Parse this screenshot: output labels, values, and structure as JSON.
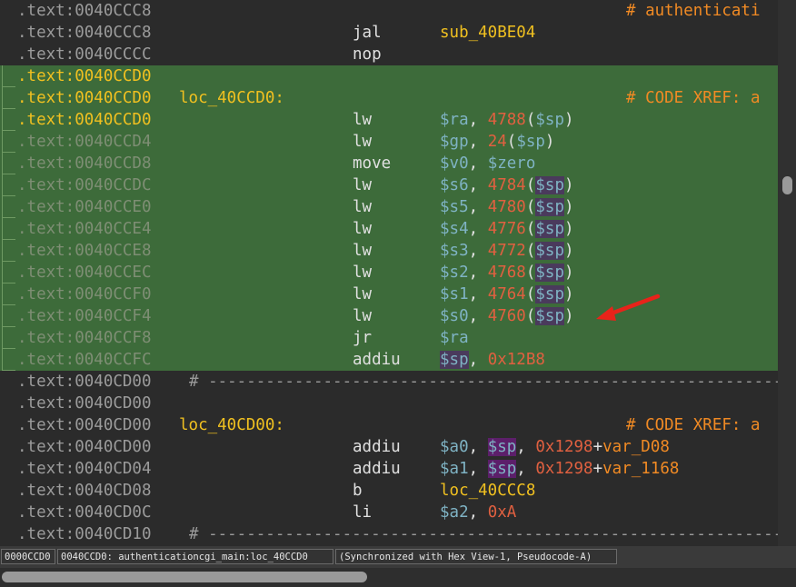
{
  "lines": [
    {
      "addr": ".text:0040CCC8",
      "label": "",
      "mn": "",
      "ops": [],
      "comment": "# authenticati",
      "hl": false,
      "ac": "c-dim"
    },
    {
      "addr": ".text:0040CCC8",
      "label": "",
      "mn": "jal",
      "ops": [
        {
          "t": "sub_40BE04",
          "c": "c-fn"
        }
      ],
      "comment": "",
      "hl": false,
      "ac": "c-dim"
    },
    {
      "addr": ".text:0040CCCC",
      "label": "",
      "mn": "nop",
      "ops": [],
      "comment": "",
      "hl": false,
      "ac": "c-dim"
    },
    {
      "addr": ".text:0040CCD0",
      "label": "",
      "mn": "",
      "ops": [],
      "comment": "",
      "hl": true,
      "ac": "c-cur"
    },
    {
      "addr": ".text:0040CCD0",
      "label": "loc_40CCD0:",
      "mn": "",
      "ops": [],
      "comment": "# CODE XREF: a",
      "hl": true,
      "ac": "c-cur"
    },
    {
      "addr": ".text:0040CCD0",
      "label": "",
      "mn": "lw",
      "ops": [
        {
          "t": "$ra",
          "c": "c-reg"
        },
        {
          "t": ", ",
          "c": "c-w"
        },
        {
          "t": "4788",
          "c": "c-num"
        },
        {
          "t": "(",
          "c": "c-w"
        },
        {
          "t": "$sp",
          "c": "c-reg"
        },
        {
          "t": ")",
          "c": "c-w"
        }
      ],
      "comment": "",
      "hl": true,
      "ac": "c-cur"
    },
    {
      "addr": ".text:0040CCD4",
      "label": "",
      "mn": "lw",
      "ops": [
        {
          "t": "$gp",
          "c": "c-reg"
        },
        {
          "t": ", ",
          "c": "c-w"
        },
        {
          "t": "24",
          "c": "c-num"
        },
        {
          "t": "(",
          "c": "c-w"
        },
        {
          "t": "$sp",
          "c": "c-reg"
        },
        {
          "t": ")",
          "c": "c-w"
        }
      ],
      "comment": "",
      "hl": true,
      "ac": "c-dimg"
    },
    {
      "addr": ".text:0040CCD8",
      "label": "",
      "mn": "move",
      "ops": [
        {
          "t": "$v0",
          "c": "c-reg"
        },
        {
          "t": ", ",
          "c": "c-w"
        },
        {
          "t": "$zero",
          "c": "c-reg"
        }
      ],
      "comment": "",
      "hl": true,
      "ac": "c-dimg"
    },
    {
      "addr": ".text:0040CCDC",
      "label": "",
      "mn": "lw",
      "ops": [
        {
          "t": "$s6",
          "c": "c-reg"
        },
        {
          "t": ", ",
          "c": "c-w"
        },
        {
          "t": "4784",
          "c": "c-num"
        },
        {
          "t": "(",
          "c": "c-w"
        },
        {
          "t": "$sp",
          "c": "c-reg",
          "h": 1
        },
        {
          "t": ")",
          "c": "c-w"
        }
      ],
      "comment": "",
      "hl": true,
      "ac": "c-dimg"
    },
    {
      "addr": ".text:0040CCE0",
      "label": "",
      "mn": "lw",
      "ops": [
        {
          "t": "$s5",
          "c": "c-reg"
        },
        {
          "t": ", ",
          "c": "c-w"
        },
        {
          "t": "4780",
          "c": "c-num"
        },
        {
          "t": "(",
          "c": "c-w"
        },
        {
          "t": "$sp",
          "c": "c-reg",
          "h": 1
        },
        {
          "t": ")",
          "c": "c-w"
        }
      ],
      "comment": "",
      "hl": true,
      "ac": "c-dimg"
    },
    {
      "addr": ".text:0040CCE4",
      "label": "",
      "mn": "lw",
      "ops": [
        {
          "t": "$s4",
          "c": "c-reg"
        },
        {
          "t": ", ",
          "c": "c-w"
        },
        {
          "t": "4776",
          "c": "c-num"
        },
        {
          "t": "(",
          "c": "c-w"
        },
        {
          "t": "$sp",
          "c": "c-reg",
          "h": 1
        },
        {
          "t": ")",
          "c": "c-w"
        }
      ],
      "comment": "",
      "hl": true,
      "ac": "c-dimg"
    },
    {
      "addr": ".text:0040CCE8",
      "label": "",
      "mn": "lw",
      "ops": [
        {
          "t": "$s3",
          "c": "c-reg"
        },
        {
          "t": ", ",
          "c": "c-w"
        },
        {
          "t": "4772",
          "c": "c-num"
        },
        {
          "t": "(",
          "c": "c-w"
        },
        {
          "t": "$sp",
          "c": "c-reg",
          "h": 1
        },
        {
          "t": ")",
          "c": "c-w"
        }
      ],
      "comment": "",
      "hl": true,
      "ac": "c-dimg"
    },
    {
      "addr": ".text:0040CCEC",
      "label": "",
      "mn": "lw",
      "ops": [
        {
          "t": "$s2",
          "c": "c-reg"
        },
        {
          "t": ", ",
          "c": "c-w"
        },
        {
          "t": "4768",
          "c": "c-num"
        },
        {
          "t": "(",
          "c": "c-w"
        },
        {
          "t": "$sp",
          "c": "c-reg",
          "h": 1
        },
        {
          "t": ")",
          "c": "c-w"
        }
      ],
      "comment": "",
      "hl": true,
      "ac": "c-dimg"
    },
    {
      "addr": ".text:0040CCF0",
      "label": "",
      "mn": "lw",
      "ops": [
        {
          "t": "$s1",
          "c": "c-reg"
        },
        {
          "t": ", ",
          "c": "c-w"
        },
        {
          "t": "4764",
          "c": "c-num"
        },
        {
          "t": "(",
          "c": "c-w"
        },
        {
          "t": "$sp",
          "c": "c-reg",
          "h": 1
        },
        {
          "t": ")",
          "c": "c-w"
        }
      ],
      "comment": "",
      "hl": true,
      "ac": "c-dimg"
    },
    {
      "addr": ".text:0040CCF4",
      "label": "",
      "mn": "lw",
      "ops": [
        {
          "t": "$s0",
          "c": "c-reg"
        },
        {
          "t": ", ",
          "c": "c-w"
        },
        {
          "t": "4760",
          "c": "c-num"
        },
        {
          "t": "(",
          "c": "c-w"
        },
        {
          "t": "$sp",
          "c": "c-reg",
          "h": 1
        },
        {
          "t": ")",
          "c": "c-w"
        }
      ],
      "comment": "",
      "hl": true,
      "ac": "c-dimg"
    },
    {
      "addr": ".text:0040CCF8",
      "label": "",
      "mn": "jr",
      "ops": [
        {
          "t": "$ra",
          "c": "c-reg"
        }
      ],
      "comment": "",
      "hl": true,
      "ac": "c-dimg"
    },
    {
      "addr": ".text:0040CCFC",
      "label": "",
      "mn": "addiu",
      "ops": [
        {
          "t": "$sp",
          "c": "c-reg",
          "h": 1
        },
        {
          "t": ", ",
          "c": "c-w"
        },
        {
          "t": "0x12B8",
          "c": "c-num"
        }
      ],
      "comment": "",
      "hl": true,
      "ac": "c-dimg"
    },
    {
      "addr": ".text:0040CD00",
      "label": "",
      "mn": "",
      "ops": [],
      "comment": "",
      "sep": "# ---------------------------------------------------------------",
      "hl": false,
      "ac": "c-dim"
    },
    {
      "addr": ".text:0040CD00",
      "label": "",
      "mn": "",
      "ops": [],
      "comment": "",
      "hl": false,
      "ac": "c-dim"
    },
    {
      "addr": ".text:0040CD00",
      "label": "loc_40CD00:",
      "mn": "",
      "ops": [],
      "comment": "# CODE XREF: a",
      "hl": false,
      "ac": "c-dim"
    },
    {
      "addr": ".text:0040CD00",
      "label": "",
      "mn": "addiu",
      "ops": [
        {
          "t": "$a0",
          "c": "c-reg"
        },
        {
          "t": ", ",
          "c": "c-w"
        },
        {
          "t": "$sp",
          "c": "c-reg",
          "h": 2
        },
        {
          "t": ", ",
          "c": "c-w"
        },
        {
          "t": "0x1298",
          "c": "c-num"
        },
        {
          "t": "+",
          "c": "c-w"
        },
        {
          "t": "var_D08",
          "c": "c-var"
        }
      ],
      "comment": "",
      "hl": false,
      "ac": "c-dim"
    },
    {
      "addr": ".text:0040CD04",
      "label": "",
      "mn": "addiu",
      "ops": [
        {
          "t": "$a1",
          "c": "c-reg"
        },
        {
          "t": ", ",
          "c": "c-w"
        },
        {
          "t": "$sp",
          "c": "c-reg",
          "h": 2
        },
        {
          "t": ", ",
          "c": "c-w"
        },
        {
          "t": "0x1298",
          "c": "c-num"
        },
        {
          "t": "+",
          "c": "c-w"
        },
        {
          "t": "var_1168",
          "c": "c-var"
        }
      ],
      "comment": "",
      "hl": false,
      "ac": "c-dim"
    },
    {
      "addr": ".text:0040CD08",
      "label": "",
      "mn": "b",
      "ops": [
        {
          "t": "loc_40CCC8",
          "c": "c-fn"
        }
      ],
      "comment": "",
      "hl": false,
      "ac": "c-dim"
    },
    {
      "addr": ".text:0040CD0C",
      "label": "",
      "mn": "li",
      "ops": [
        {
          "t": "$a2",
          "c": "c-reg"
        },
        {
          "t": ", ",
          "c": "c-w"
        },
        {
          "t": "0xA",
          "c": "c-num"
        }
      ],
      "comment": "",
      "hl": false,
      "ac": "c-dim"
    },
    {
      "addr": ".text:0040CD10",
      "label": "",
      "mn": "",
      "ops": [],
      "comment": "",
      "sep": "# ---------------------------------------------------------------",
      "hl": false,
      "ac": "c-dim"
    }
  ],
  "status": {
    "offset": "0000CCD0",
    "location": "0040CCD0: authenticationcgi_main:loc_40CCD0",
    "sync": "(Synchronized with Hex View-1, Pseudocode-A)"
  },
  "colors": {
    "background": "#2b2b2b",
    "highlight": "#3d6b3a",
    "register": "#7fb3c4",
    "number": "#e06040",
    "label": "#f0c020",
    "comment": "#f08a24",
    "arrow": "#e8231a"
  },
  "annotation_icon": "red-arrow-icon"
}
